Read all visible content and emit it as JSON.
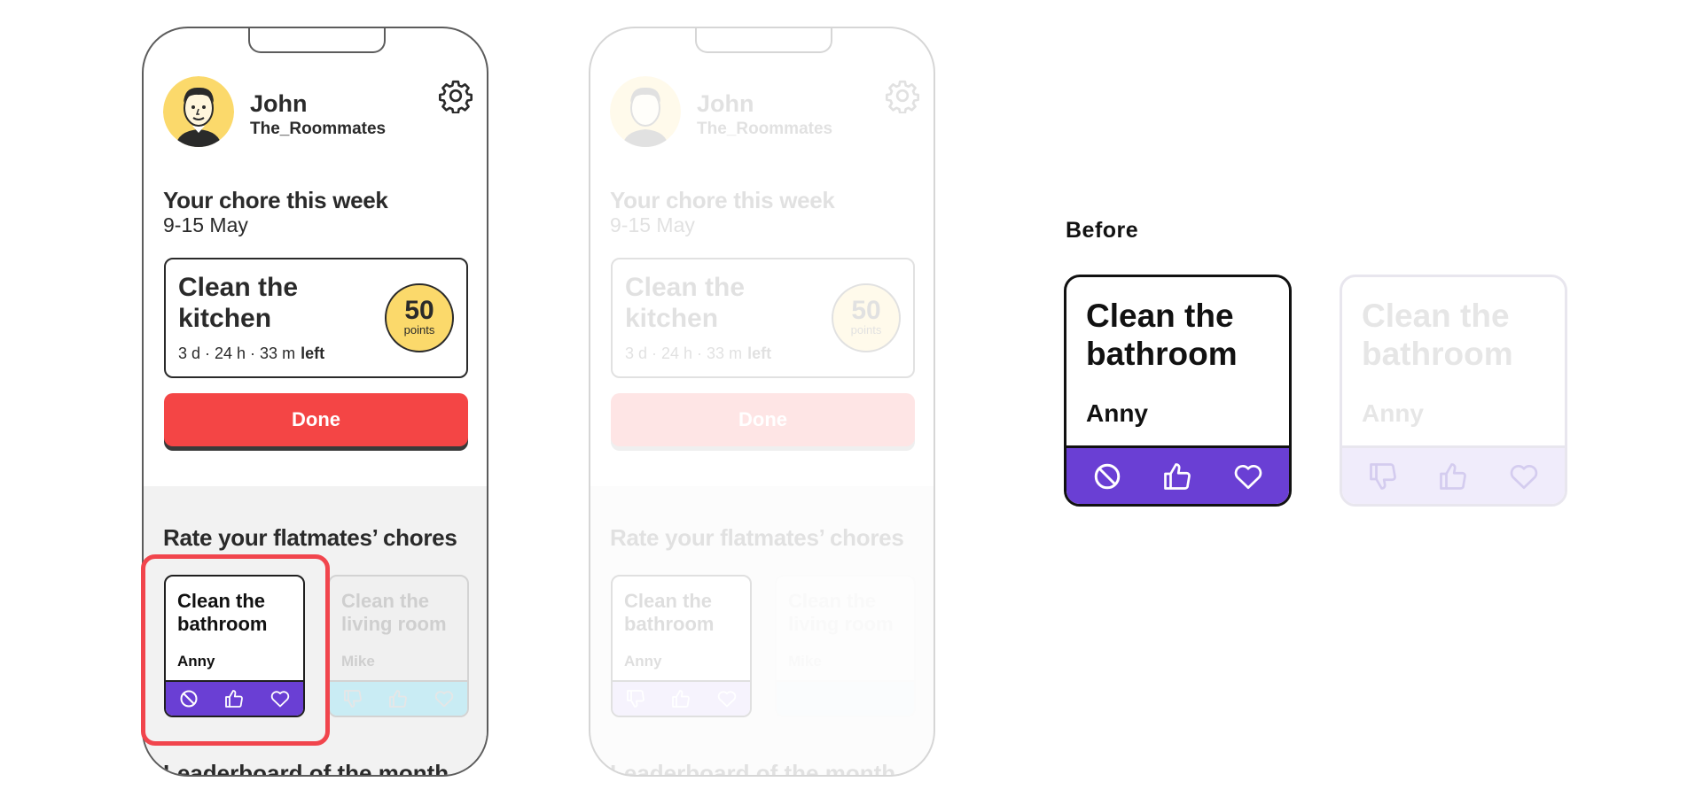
{
  "phone": {
    "user": {
      "name": "John",
      "group": "The_Roommates"
    },
    "chore_section": {
      "title": "Your chore this week",
      "week": "9-15 May"
    },
    "chore_card": {
      "title": "Clean the kitchen",
      "time_left": "3 d · 24 h · 33 m",
      "left_word": "left",
      "points_value": "50",
      "points_label": "points"
    },
    "done_label": "Done",
    "rate_title": "Rate your flatmates’ chores",
    "flatmate_chores": [
      {
        "title": "Clean the bathroom",
        "assignee": "Anny"
      },
      {
        "title": "Clean the living room",
        "assignee": "Mike"
      }
    ],
    "leaderboard_title": "Leaderboard of the month"
  },
  "before_label": "Before",
  "before_card": {
    "title": "Clean the bathroom",
    "assignee": "Anny",
    "actions": [
      "block-icon",
      "thumbs-up-icon",
      "heart-icon"
    ]
  },
  "faded_before_card_actions": [
    "thumbs-down-icon",
    "thumbs-up-icon",
    "heart-icon"
  ],
  "colors": {
    "accent_purple": "#6a3fd4",
    "done_red": "#f44545",
    "points_yellow": "#fbd96b",
    "highlight_red": "#f1454d",
    "living_room_action_bar": "#c9ecf4"
  }
}
